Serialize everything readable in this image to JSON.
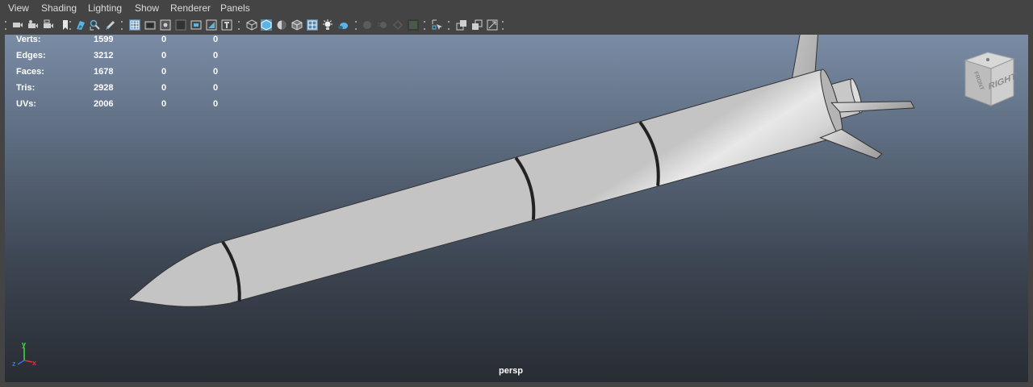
{
  "menu": [
    "View",
    "Shading",
    "Lighting",
    "Show",
    "Renderer",
    "Panels"
  ],
  "toolbar_icons": [
    "select-camera-icon",
    "camera-attributes-icon",
    "camera-film-icon",
    "bookmark-icon",
    "image-plane-icon",
    "2d-pan-zoom-icon",
    "grease-pencil-icon",
    "grid-icon",
    "film-gate-icon",
    "resolution-gate-icon",
    "gate-mask-icon",
    "field-chart-icon",
    "safe-action-icon",
    "safe-title-icon",
    "isolate-select-icon",
    "wireframe-icon",
    "smooth-shade-icon",
    "use-default-material-icon",
    "wireframe-on-shaded-icon",
    "xray-icon",
    "use-all-lights-icon",
    "shadows-icon",
    "screen-space-ao-icon",
    "motion-blur-icon",
    "multisample-aa-icon",
    "depth-of-field-icon",
    "isolate-icon",
    "xray-joints-icon",
    "xray-components-icon",
    "frame-all-icon"
  ],
  "stats": {
    "rows": [
      {
        "label": "Verts:",
        "v1": "1599",
        "v2": "0",
        "v3": "0"
      },
      {
        "label": "Edges:",
        "v1": "3212",
        "v2": "0",
        "v3": "0"
      },
      {
        "label": "Faces:",
        "v1": "1678",
        "v2": "0",
        "v3": "0"
      },
      {
        "label": "Tris:",
        "v1": "2928",
        "v2": "0",
        "v3": "0"
      },
      {
        "label": "UVs:",
        "v1": "2006",
        "v2": "0",
        "v3": "0"
      }
    ]
  },
  "viewcube": {
    "right": "RIGHT",
    "front": "FRONT"
  },
  "axis": {
    "x": "x",
    "y": "y",
    "z": "z"
  },
  "camera_label": "persp",
  "colors": {
    "accent": "#5ab4e4",
    "viewport_top": "#7a8ca5",
    "viewport_bottom": "#282c33",
    "panel_bg": "#444444",
    "axis_x": "#e03030",
    "axis_y": "#40e040",
    "axis_z": "#3a6cf0"
  }
}
